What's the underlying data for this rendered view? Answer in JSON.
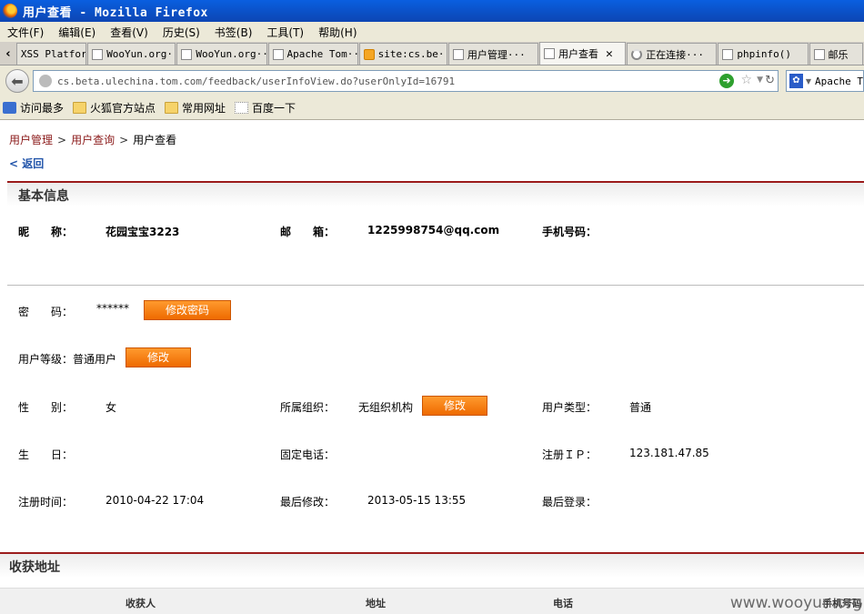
{
  "window": {
    "title": "用户查看 - Mozilla Firefox"
  },
  "menu": [
    "文件(F)",
    "编辑(E)",
    "查看(V)",
    "历史(S)",
    "书签(B)",
    "工具(T)",
    "帮助(H)"
  ],
  "tabs": [
    {
      "label": "XSS Platform"
    },
    {
      "label": "WooYun.org···"
    },
    {
      "label": "WooYun.org···"
    },
    {
      "label": "Apache Tom···"
    },
    {
      "label": "site:cs.be···"
    },
    {
      "label": "用户管理···"
    },
    {
      "label": "用户查看"
    },
    {
      "label": "正在连接···"
    },
    {
      "label": "phpinfo()"
    },
    {
      "label": "邮乐"
    }
  ],
  "address": {
    "url": "cs.beta.ulechina.tom.com/feedback/userInfoView.do?userOnlyId=16791"
  },
  "search": {
    "engine": "Apache T"
  },
  "bookmarks": [
    "访问最多",
    "火狐官方站点",
    "常用网址",
    "百度一下"
  ],
  "breadcrumb": {
    "item1": "用户管理",
    "item2": "用户查询",
    "current": "用户查看",
    "sep": ">"
  },
  "back_link": "< 返回",
  "basic": {
    "title": "基本信息",
    "nickname_label": "昵　　称：",
    "nickname": "花园宝宝3223",
    "email_label": "邮　　箱：",
    "email": "1225998754@qq.com",
    "mobile_label": "手机号码：",
    "password_label": "密　　码：",
    "password": "******",
    "change_password": "修改密码",
    "level_label": "用户等级：",
    "level": "普通用户",
    "modify": "修改",
    "gender_label": "性　　别：",
    "gender": "女",
    "org_label": "所属组织：",
    "org": "无组织机构",
    "type_label": "用户类型：",
    "type": "普通",
    "birthday_label": "生　　日：",
    "phone_label": "固定电话：",
    "reg_ip_label": "注册ＩＰ：",
    "reg_ip": "123.181.47.85",
    "reg_time_label": "注册时间：",
    "reg_time": "2010-04-22 17:04",
    "last_modified_label": "最后修改：",
    "last_modified": "2013-05-15 13:55",
    "last_login_label": "最后登录："
  },
  "address_section": {
    "title": "收获地址",
    "columns": [
      "收获人",
      "地址",
      "电话",
      "手机号码"
    ]
  },
  "watermark": "www.wooyun.org"
}
